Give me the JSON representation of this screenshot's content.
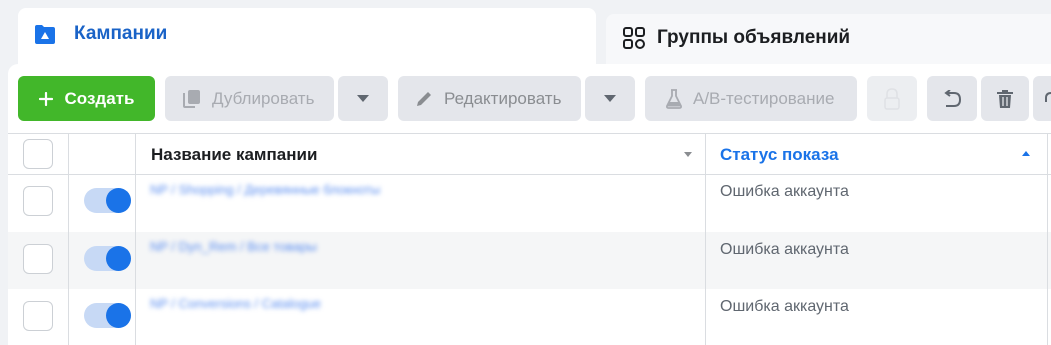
{
  "tabs": {
    "campaigns": {
      "label": "Кампании",
      "icon": "folder-icon"
    },
    "ad_groups": {
      "label": "Группы объявлений",
      "icon": "grid-icon"
    }
  },
  "toolbar": {
    "create_label": "Создать",
    "duplicate_label": "Дублировать",
    "edit_label": "Редактировать",
    "ab_label": "A/B-тестирование"
  },
  "table": {
    "columns": {
      "name": "Название кампании",
      "status": "Статус показа"
    },
    "rows": [
      {
        "name": "NP / Shopping / Деревянные блокноты",
        "status": "Ошибка аккаунта",
        "active": true
      },
      {
        "name": "NP / Dyn_Rem / Все товары",
        "status": "Ошибка аккаунта",
        "active": true
      },
      {
        "name": "NP / Conversions / Catalogue",
        "status": "Ошибка аккаунта",
        "active": true
      }
    ]
  },
  "colors": {
    "accent": "#1a73e8",
    "create_button": "#42b72a",
    "tab_active": "#1a63c7"
  }
}
